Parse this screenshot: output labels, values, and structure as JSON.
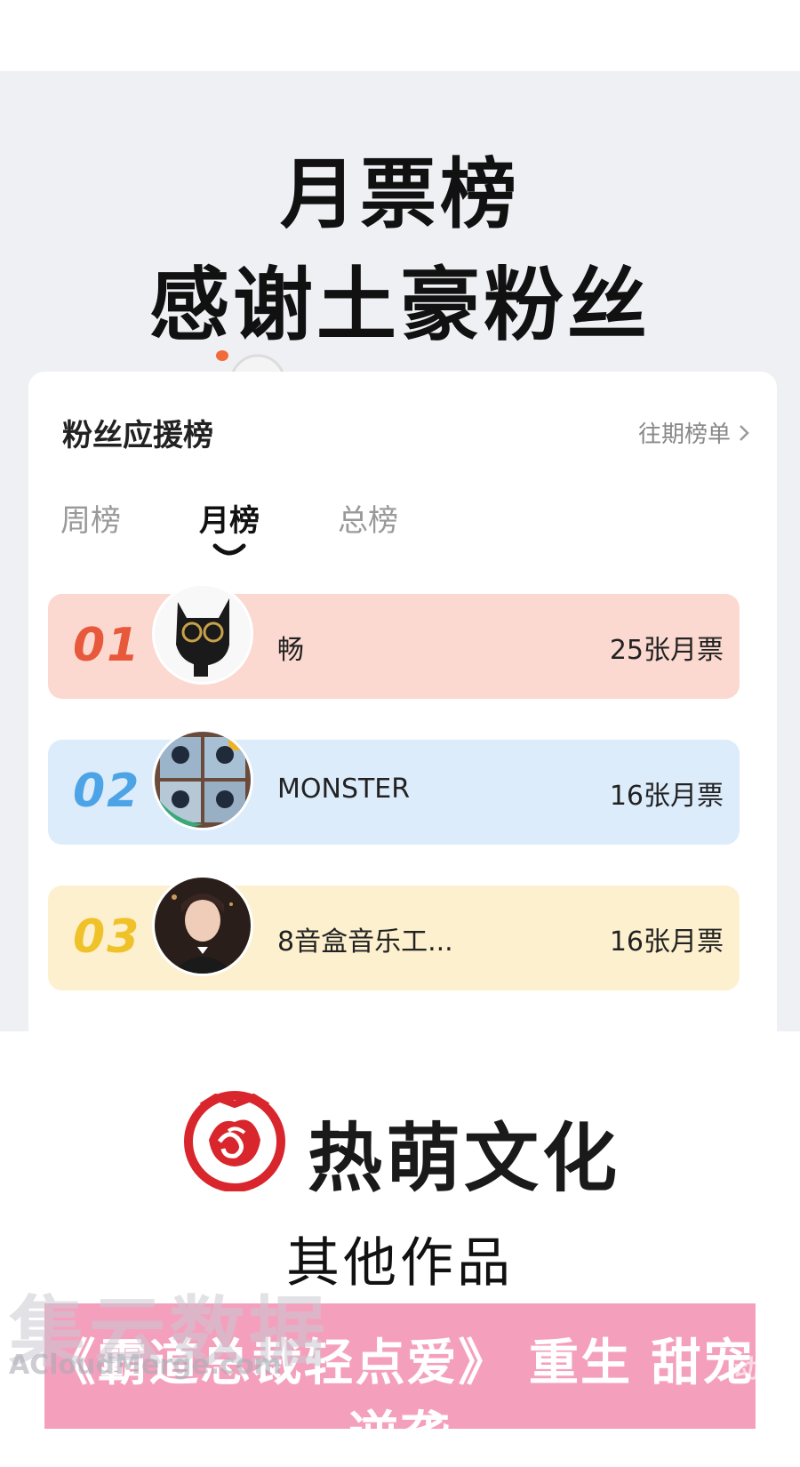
{
  "headline": {
    "line1": "月票榜",
    "line2": "感谢土豪粉丝"
  },
  "card": {
    "title": "粉丝应援榜",
    "history_link": "往期榜单",
    "tabs": [
      {
        "label": "周榜",
        "active": false
      },
      {
        "label": "月榜",
        "active": true
      },
      {
        "label": "总榜",
        "active": false
      }
    ],
    "ranks": [
      {
        "rank": "01",
        "name": "畅",
        "votes": "25张月票",
        "bg": "#fbd9d0",
        "num_color": "#e8583b"
      },
      {
        "rank": "02",
        "name": "MONSTER",
        "votes": "16张月票",
        "bg": "#dcecfb",
        "num_color": "#4ca3e6"
      },
      {
        "rank": "03",
        "name": "8音盒音乐工...",
        "votes": "16张月票",
        "bg": "#fdf0cf",
        "num_color": "#f0c22a"
      }
    ]
  },
  "brand": {
    "name": "热萌文化",
    "logo_color": "#d9262c"
  },
  "others_label": "其他作品",
  "banner": {
    "text": "《霸道总裁轻点爱》 重生 甜宠 逆袭"
  },
  "watermark": {
    "main": "集云数据",
    "sub": "ACloudMerge.com",
    "right": "动漫"
  }
}
